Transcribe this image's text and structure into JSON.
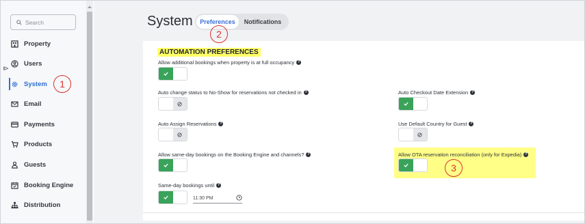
{
  "sidebar": {
    "search_placeholder": "Search",
    "items": [
      {
        "label": "Property",
        "icon": "building-icon"
      },
      {
        "label": "Users",
        "icon": "user-circle-icon"
      },
      {
        "label": "System",
        "icon": "gear-icon",
        "active": true
      },
      {
        "label": "Email",
        "icon": "envelope-icon"
      },
      {
        "label": "Payments",
        "icon": "credit-card-icon"
      },
      {
        "label": "Products",
        "icon": "cart-icon"
      },
      {
        "label": "Guests",
        "icon": "person-icon"
      },
      {
        "label": "Booking Engine",
        "icon": "calendar-icon"
      },
      {
        "label": "Distribution",
        "icon": "sitemap-icon"
      }
    ]
  },
  "header": {
    "title": "System",
    "tabs": [
      {
        "label": "Preferences",
        "active": true
      },
      {
        "label": "Notifications",
        "active": false
      }
    ]
  },
  "automation": {
    "section_title": "AUTOMATION PREFERENCES",
    "settings": [
      {
        "label": "Allow additional bookings when property is at full occupancy",
        "state": "on"
      },
      {
        "label": "Auto change status to No-Show for reservations not checked in",
        "state": "off"
      },
      {
        "label": "Auto Checkout Date Extension",
        "state": "on"
      },
      {
        "label": "Auto Assign Reservations",
        "state": "off"
      },
      {
        "label": "Use Default Country for Guest",
        "state": "off"
      },
      {
        "label": "Allow same-day bookings on the Booking Engine and channels?",
        "state": "on"
      },
      {
        "label": "Allow OTA reservation reconciliation (only for Expedia)",
        "state": "on"
      },
      {
        "label": "Same-day bookings until",
        "state": "on"
      }
    ],
    "same_day_time": "11:30 PM"
  },
  "annotations": [
    "1",
    "2",
    "3"
  ],
  "colors": {
    "accent_blue": "#2f6fd0",
    "toggle_green": "#3aa35a",
    "highlight_yellow": "#ffff66",
    "callout_red": "#d9322b"
  }
}
